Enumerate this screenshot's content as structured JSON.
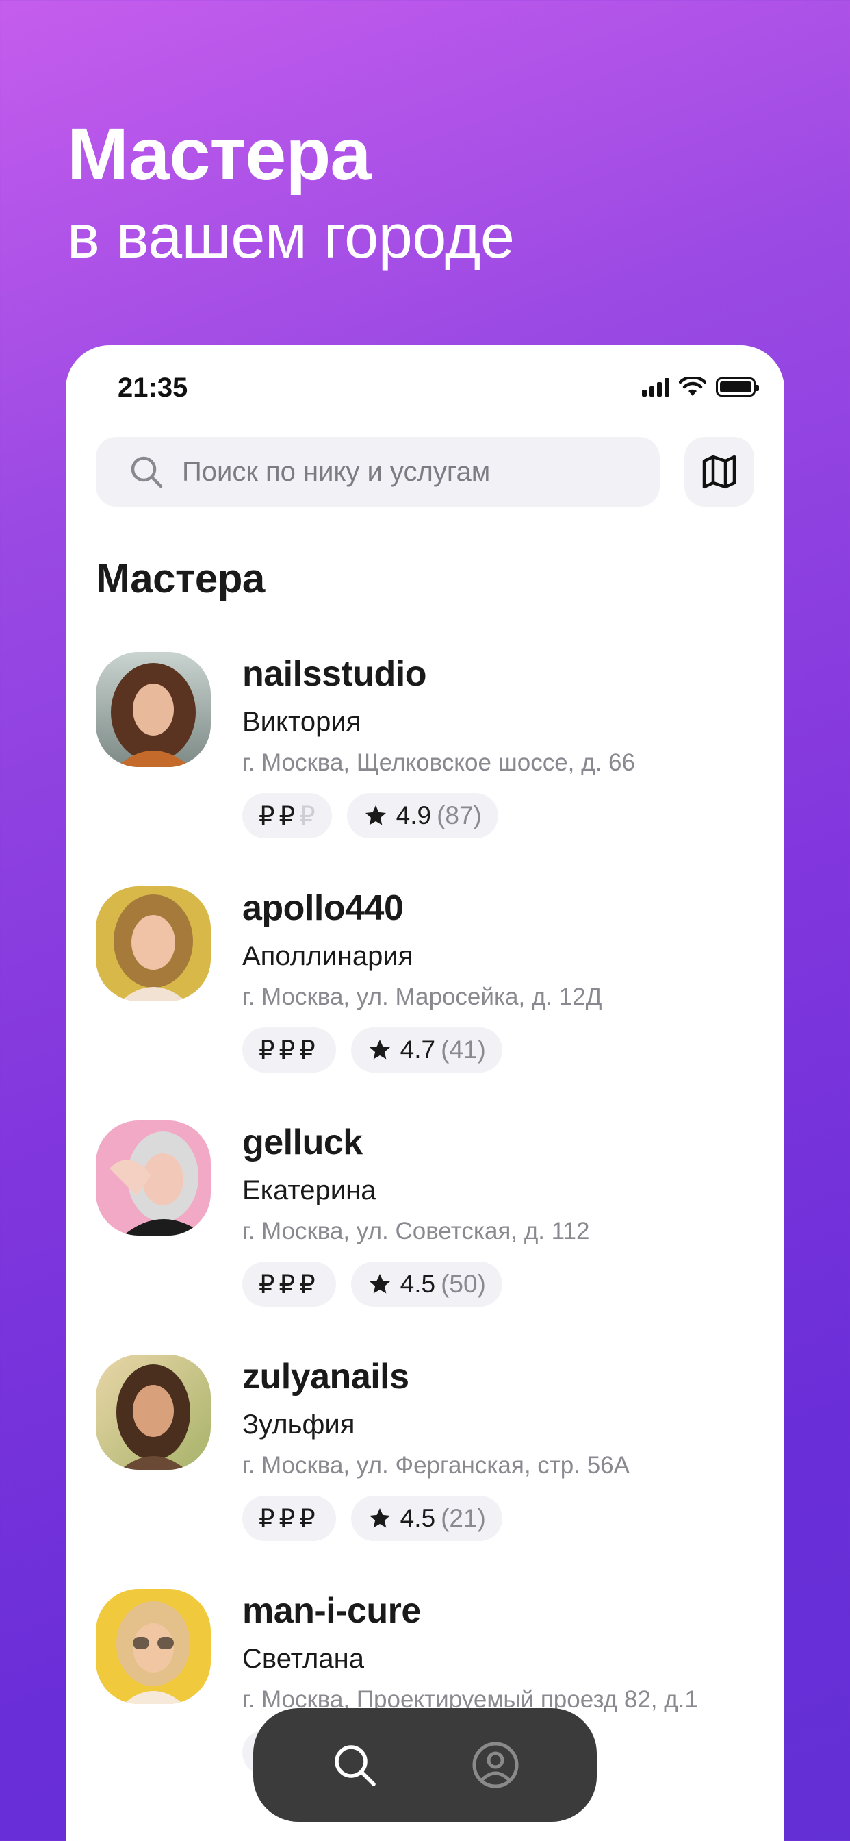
{
  "headline": {
    "title": "Мастера",
    "subtitle": "в вашем городе"
  },
  "status_bar": {
    "time": "21:35"
  },
  "search": {
    "placeholder": "Поиск по нику и услугам",
    "icon": "search-icon"
  },
  "map_button": {
    "icon": "map-icon"
  },
  "section_title": "Мастера",
  "masters": [
    {
      "nick": "nailsstudio",
      "name": "Виктория",
      "address": "г. Москва, Щелковское шоссе, д. 66",
      "price_level": 2,
      "price_max": 3,
      "rating": "4.9",
      "reviews": "(87)"
    },
    {
      "nick": "apollo440",
      "name": "Аполлинария",
      "address": "г. Москва, ул. Маросейка, д. 12Д",
      "price_level": 3,
      "price_max": 3,
      "rating": "4.7",
      "reviews": "(41)"
    },
    {
      "nick": "gelluck",
      "name": "Екатерина",
      "address": "г. Москва, ул. Советская, д. 112",
      "price_level": 3,
      "price_max": 3,
      "rating": "4.5",
      "reviews": "(50)"
    },
    {
      "nick": "zulyanails",
      "name": "Зульфия",
      "address": "г. Москва, ул. Ферганская, стр. 56А",
      "price_level": 3,
      "price_max": 3,
      "rating": "4.5",
      "reviews": "(21)"
    },
    {
      "nick": "man-i-cure",
      "name": "Светлана",
      "address": "г. Москва, Проектируемый проезд 82, д.1",
      "price_level": 3,
      "price_max": 3,
      "rating": "",
      "reviews": ""
    }
  ],
  "currency_symbol": "₽",
  "tabbar": {
    "tabs": [
      {
        "icon": "search-icon",
        "active": true
      },
      {
        "icon": "profile-icon",
        "active": false
      }
    ]
  },
  "colors": {
    "accent_gradient_start": "#c55ded",
    "accent_gradient_end": "#6330d6",
    "chip_bg": "#f2f1f5",
    "tabbar_bg": "#3b3b3b"
  }
}
